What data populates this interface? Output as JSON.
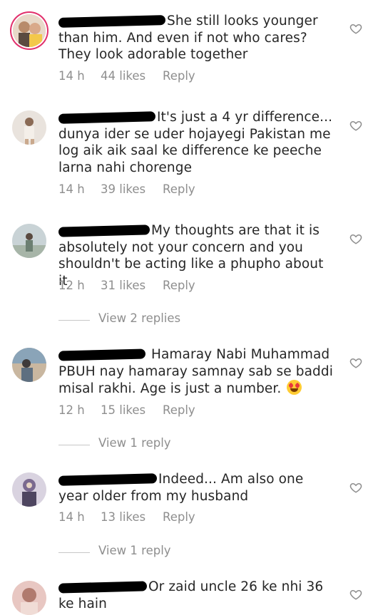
{
  "comments": [
    {
      "text": "She still looks younger than him. And even if not who cares? They look adorable together",
      "time": "14 h",
      "likes": "44 likes",
      "reply": "Reply",
      "avatar_colors": [
        "#b88b6b",
        "#f3c84a"
      ]
    },
    {
      "text": "It's just a 4 yr difference... dunya ider se uder hojayegi Pakistan me log aik aik saal ke difference ke peeche larna nahi chorenge",
      "time": "14 h",
      "likes": "39 likes",
      "reply": "Reply",
      "avatar_colors": [
        "#e9e3dd",
        "#caa98d"
      ]
    },
    {
      "text": "My thoughts are that it is absolutely not your concern and you shouldn't be acting like a phupho about it",
      "time": "12 h",
      "likes": "31 likes",
      "reply": "Reply",
      "view_replies": "View 2 replies",
      "avatar_colors": [
        "#c9d3d6",
        "#6c7f72"
      ]
    },
    {
      "text_line1": "Hamaray Nabi Muhammad",
      "text_rest": "PBUH nay hamaray samnay sab se baddi misal rakhi. Age is just a number.",
      "time": "12 h",
      "likes": "15 likes",
      "reply": "Reply",
      "view_replies": "View 1 reply",
      "emoji": "heart-eyes-emoji",
      "avatar_colors": [
        "#8aa4b8",
        "#c9b7a0"
      ]
    },
    {
      "text": "Indeed... Am also one year older from my husband",
      "time": "14 h",
      "likes": "13 likes",
      "reply": "Reply",
      "view_replies": "View 1 reply",
      "avatar_colors": [
        "#d9d3e0",
        "#7a6a8f"
      ]
    },
    {
      "text": "Or zaid uncle 26 ke nhi 36 ke hain",
      "avatar_colors": [
        "#e8c7c2",
        "#b07a6e"
      ]
    }
  ],
  "icons": {
    "like": "heart-outline-icon",
    "redaction": "username-redaction"
  },
  "colors": {
    "meta": "#8e8e8e",
    "text": "#262626",
    "line": "#c7c7c7"
  }
}
